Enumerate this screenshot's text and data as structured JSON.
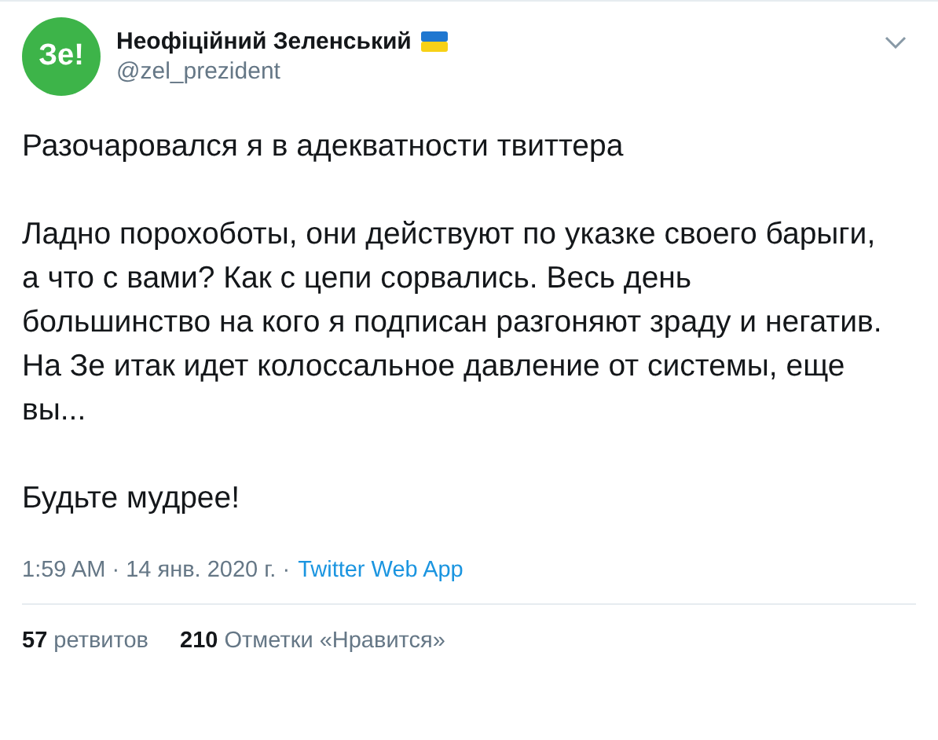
{
  "author": {
    "avatar_text": "Зе!",
    "name": "Неофіційний Зеленський",
    "handle": "@zel_prezident"
  },
  "tweet": {
    "paragraphs": [
      "Разочаровался я в адекватности твиттера",
      "Ладно порохоботы, они действуют по указке своего барыги, а что с вами? Как с цепи сорвались. Весь день большинство на кого я подписан разгоняют зраду и негатив. На Зе итак идет колоссальное давление от системы, еще вы...",
      "Будьте мудрее!"
    ]
  },
  "meta": {
    "timestamp": "1:59 AM · 14 янв. 2020 г. ·",
    "source": "Twitter Web App"
  },
  "stats": [
    {
      "count": "57",
      "label": "ретвитов"
    },
    {
      "count": "210",
      "label": "Отметки «Нравится»"
    }
  ]
}
